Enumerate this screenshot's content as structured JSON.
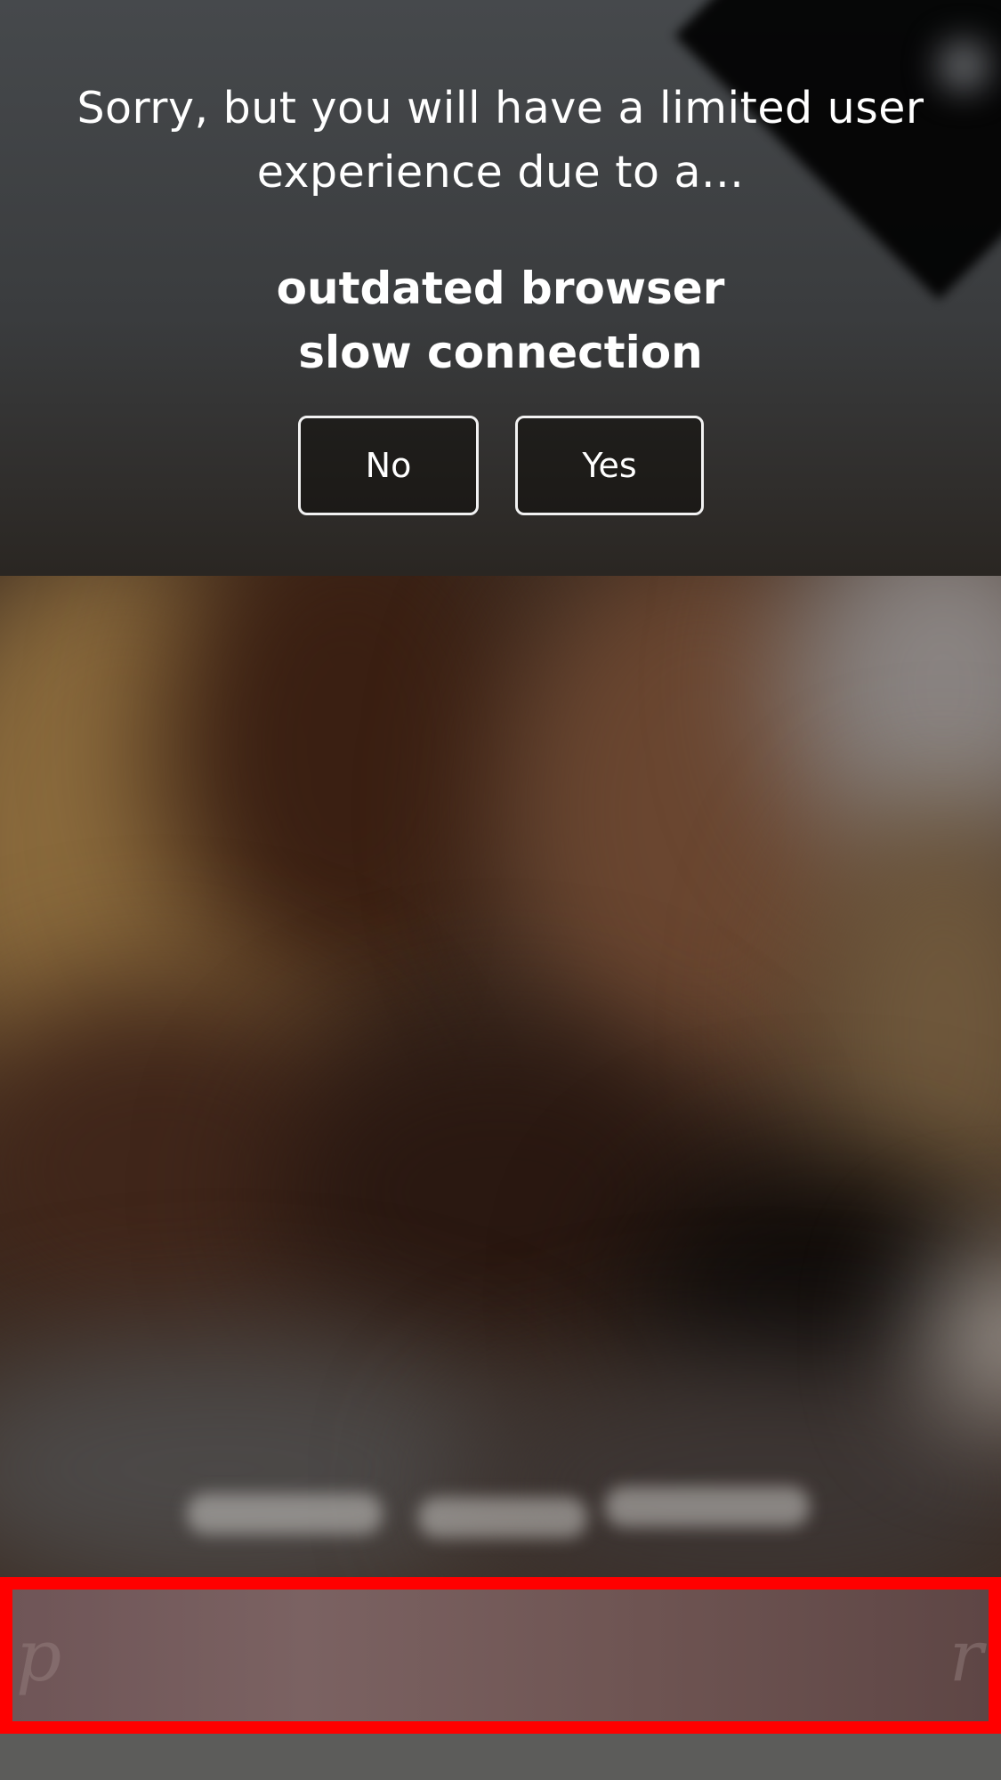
{
  "notice": {
    "lead_text": "Sorry, but you will have a limited user experience due to a...",
    "reasons": [
      "outdated browser",
      "slow connection"
    ],
    "buttons": {
      "no_label": "No",
      "yes_label": "Yes"
    }
  },
  "colors": {
    "banner_background": "#3e4143",
    "button_border": "#f2f2f2",
    "highlight_border": "#ff0000",
    "page_background": "#5a5a58"
  }
}
